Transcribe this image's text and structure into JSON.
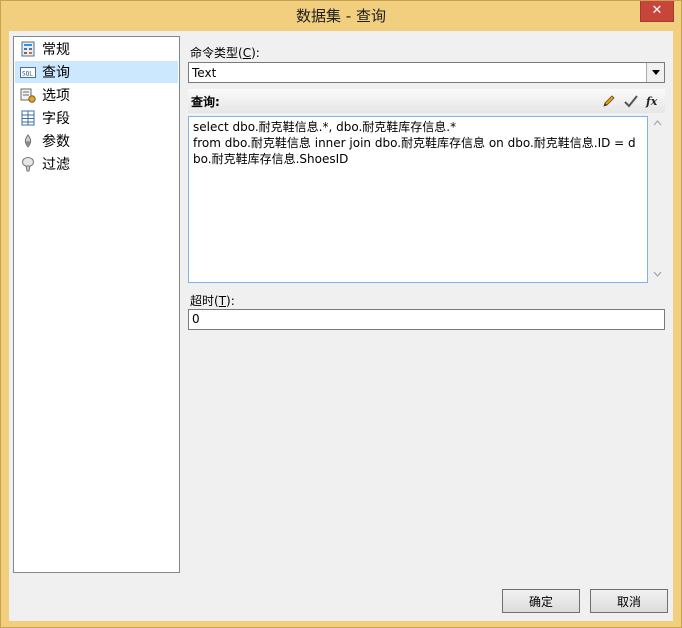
{
  "window": {
    "title": "数据集 - 查询",
    "close_glyph": "✕"
  },
  "nav": {
    "items": [
      {
        "label": "常规",
        "icon": "general-icon",
        "selected": false
      },
      {
        "label": "查询",
        "icon": "query-icon",
        "selected": true
      },
      {
        "label": "选项",
        "icon": "options-icon",
        "selected": false
      },
      {
        "label": "字段",
        "icon": "fields-icon",
        "selected": false
      },
      {
        "label": "参数",
        "icon": "parameters-icon",
        "selected": false
      },
      {
        "label": "过滤",
        "icon": "filter-icon",
        "selected": false
      }
    ]
  },
  "command_type": {
    "label_prefix": "命令类型(",
    "label_key": "C",
    "label_suffix": "):",
    "value": "Text"
  },
  "query": {
    "label": "查询:",
    "tools": [
      "edit-pencil-icon",
      "validate-check-icon",
      "function-fx-icon"
    ],
    "text": "select dbo.耐克鞋信息.*, dbo.耐克鞋库存信息.*\nfrom dbo.耐克鞋信息 inner join dbo.耐克鞋库存信息 on dbo.耐克鞋信息.ID = dbo.耐克鞋库存信息.ShoesID"
  },
  "timeout": {
    "label_prefix": "超时(",
    "label_key": "T",
    "label_suffix": "):",
    "value": "0"
  },
  "buttons": {
    "ok": "确定",
    "cancel": "取消"
  }
}
